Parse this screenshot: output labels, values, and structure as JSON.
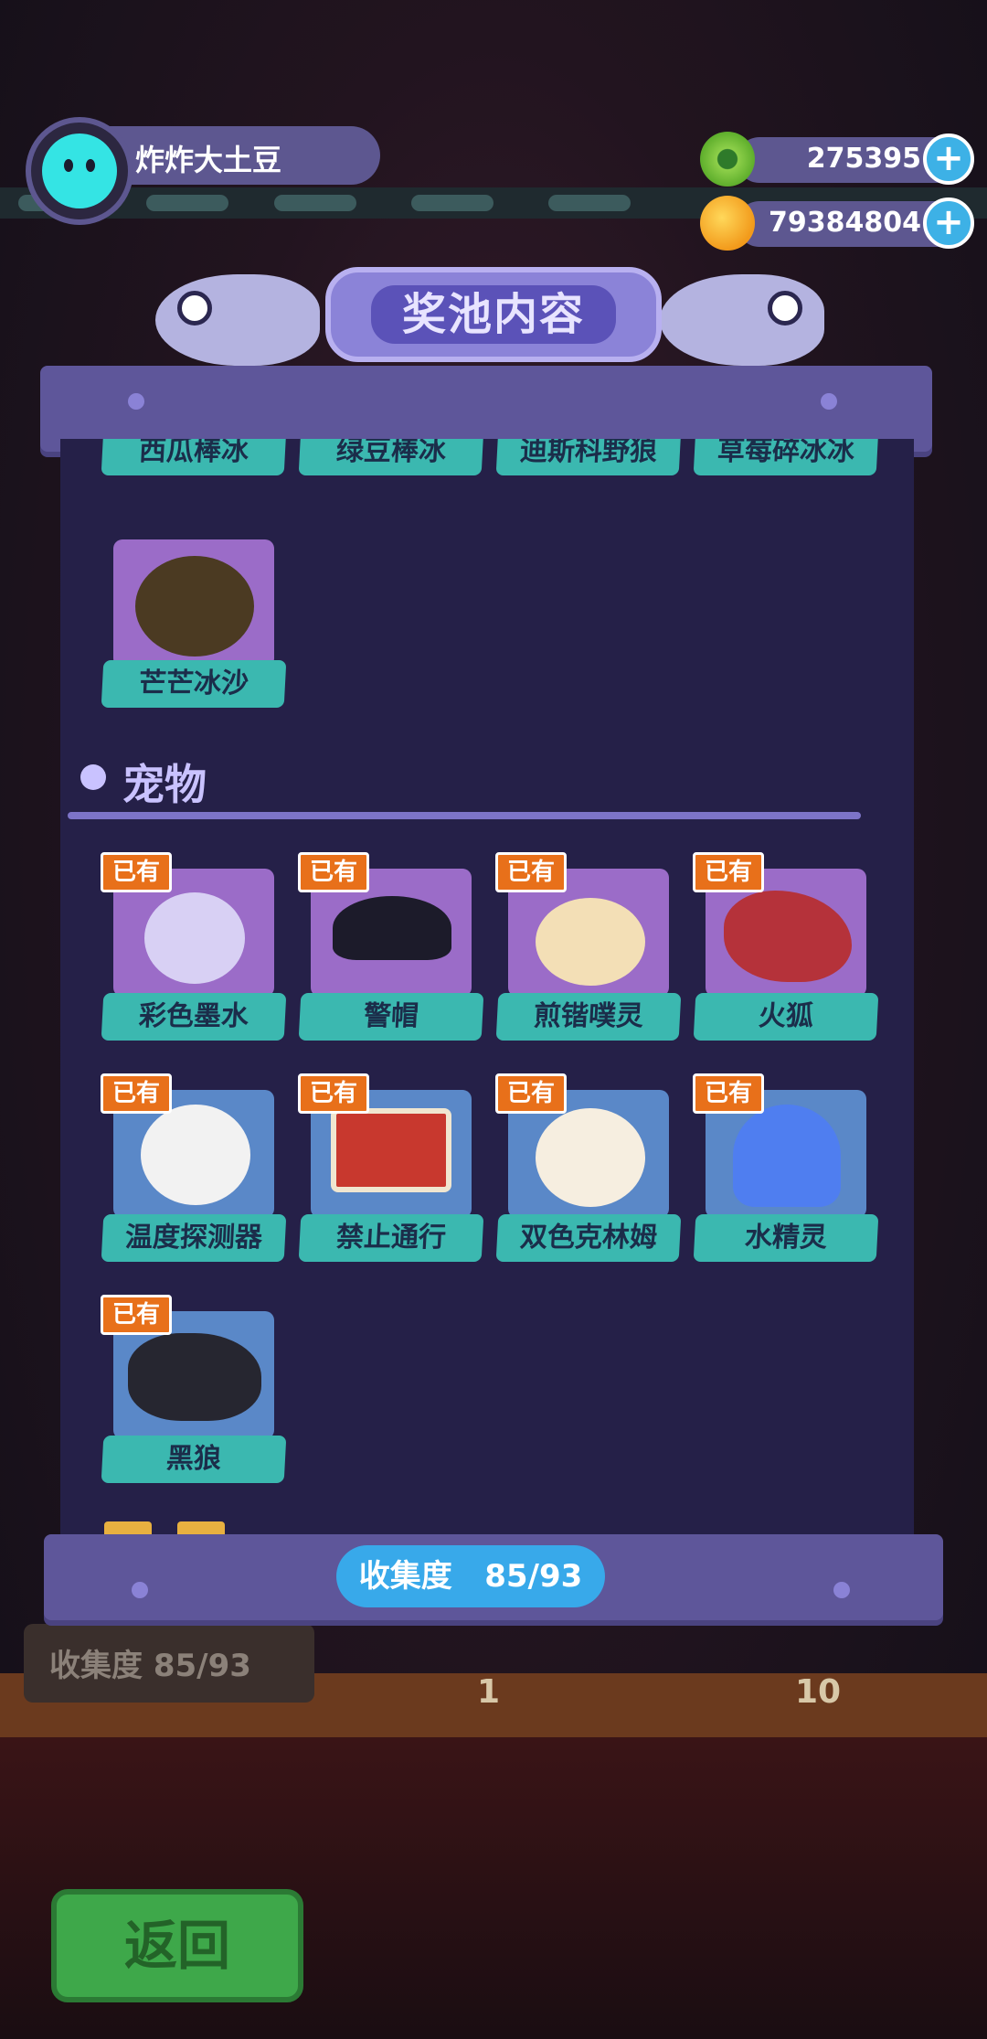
{
  "player": {
    "name": "炸炸大土豆"
  },
  "currency": [
    {
      "value": "275395",
      "icon": "green-gem-coin-icon"
    },
    {
      "value": "79384804",
      "icon": "orange-planet-coin-icon"
    }
  ],
  "title": "奖池内容",
  "partial_row": [
    "西瓜棒冰",
    "绿豆棒冰",
    "迪斯科野狼",
    "草莓碎冰冰"
  ],
  "desserts_last": "芒芒冰沙",
  "section": "宠物",
  "owned_label": "已有",
  "pets": [
    {
      "name": "彩色墨水",
      "owned": true
    },
    {
      "name": "警帽",
      "owned": true
    },
    {
      "name": "煎锴噗灵",
      "owned": true
    },
    {
      "name": "火狐",
      "owned": true
    },
    {
      "name": "温度探测器",
      "owned": true
    },
    {
      "name": "禁止通行",
      "owned": true
    },
    {
      "name": "双色克林姆",
      "owned": true
    },
    {
      "name": "水精灵",
      "owned": true
    },
    {
      "name": "黑狼",
      "owned": true
    }
  ],
  "collection": {
    "label": "收集度",
    "value": "85/93"
  },
  "background": {
    "collection_text": "收集度 85/93",
    "stage_left": "1",
    "stage_right": "10"
  },
  "back_button": "返回",
  "colors": {
    "panel": "#252048",
    "frame": "#5e569a",
    "tag": "#3bb8b0",
    "badge": "#e8701a",
    "pill": "#38a9ea"
  }
}
